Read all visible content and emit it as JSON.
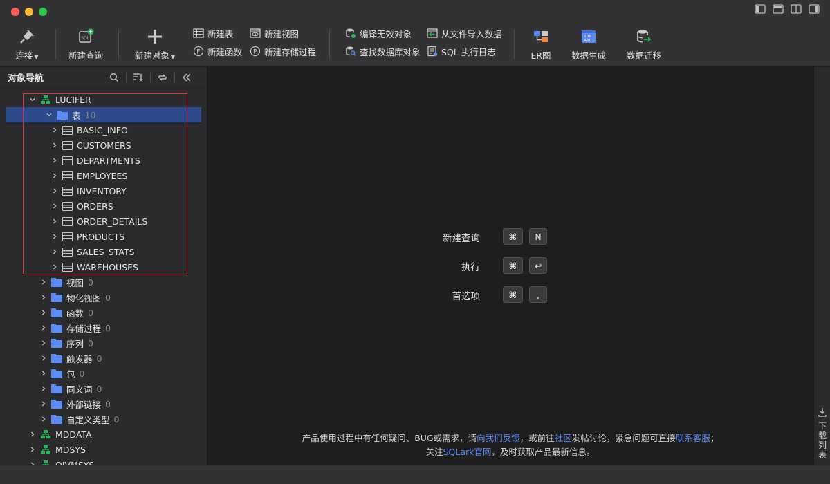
{
  "toolbar": {
    "connect": "连接",
    "new_query": "新建查询",
    "new_object": "新建对象",
    "new_table": "新建表",
    "new_view": "新建视图",
    "new_function": "新建函数",
    "new_procedure": "新建存储过程",
    "compile_invalid": "编译无效对象",
    "find_objects": "查找数据库对象",
    "import_from_file": "从文件导入数据",
    "sql_log": "SQL 执行日志",
    "er_diagram": "ER图",
    "data_generation": "数据生成",
    "data_migration": "数据迁移"
  },
  "sidebar": {
    "title": "对象导航",
    "schema": "LUCIFER",
    "tables_folder": {
      "label": "表",
      "count": "10"
    },
    "tables": [
      "BASIC_INFO",
      "CUSTOMERS",
      "DEPARTMENTS",
      "EMPLOYEES",
      "INVENTORY",
      "ORDERS",
      "ORDER_DETAILS",
      "PRODUCTS",
      "SALES_STATS",
      "WAREHOUSES"
    ],
    "folders": [
      {
        "label": "视图",
        "count": "0"
      },
      {
        "label": "物化视图",
        "count": "0"
      },
      {
        "label": "函数",
        "count": "0"
      },
      {
        "label": "存储过程",
        "count": "0"
      },
      {
        "label": "序列",
        "count": "0"
      },
      {
        "label": "触发器",
        "count": "0"
      },
      {
        "label": "包",
        "count": "0"
      },
      {
        "label": "同义词",
        "count": "0"
      },
      {
        "label": "外部链接",
        "count": "0"
      },
      {
        "label": "自定义类型",
        "count": "0"
      }
    ],
    "other_schemas": [
      "MDDATA",
      "MDSYS",
      "OJVMSYS"
    ]
  },
  "shortcuts": [
    {
      "label": "新建查询",
      "keys": [
        "⌘",
        "N"
      ]
    },
    {
      "label": "执行",
      "keys": [
        "⌘",
        "↩"
      ]
    },
    {
      "label": "首选项",
      "keys": [
        "⌘",
        ","
      ]
    }
  ],
  "footer": {
    "line1_a": "产品使用过程中有任何疑问、BUG或需求，请",
    "link_feedback": "向我们反馈",
    "line1_b": "，或前往",
    "link_community": "社区",
    "line1_c": "发帖讨论，紧急问题可直接",
    "link_support": "联系客服",
    "line1_d": "；",
    "line2_a": "关注",
    "link_site": "SQLark官网",
    "line2_b": "，及时获取产品最新信息。"
  },
  "rightbar": {
    "download_list": [
      "下",
      "载",
      "列",
      "表"
    ]
  }
}
